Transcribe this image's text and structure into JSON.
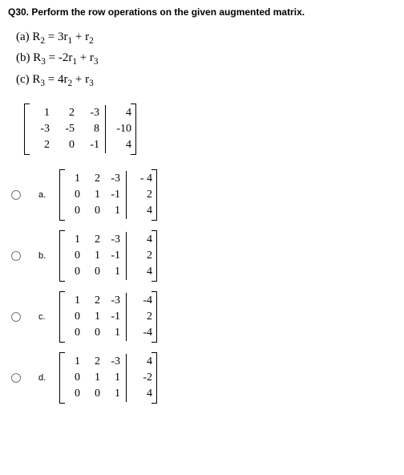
{
  "title": "Q30. Perform the row operations on the given augmented matrix.",
  "ops": {
    "a_prefix": "(a) R",
    "a_sub1": "2",
    "a_mid": " = 3r",
    "a_sub2": "1",
    "a_mid2": " + r",
    "a_sub3": "2",
    "b_prefix": "(b) R",
    "b_sub1": "3",
    "b_mid": " = -2r",
    "b_sub2": "1",
    "b_mid2": " + r",
    "b_sub3": "3",
    "c_prefix": "(c) R",
    "c_sub1": "3",
    "c_mid": " =  4r",
    "c_sub2": "2",
    "c_mid2": " + r",
    "c_sub3": "3"
  },
  "main_matrix": {
    "rows": [
      {
        "c1": "1",
        "c2": "2",
        "c3": "-3",
        "r": "4"
      },
      {
        "c1": "-3",
        "c2": "-5",
        "c3": "8",
        "r": "-10"
      },
      {
        "c1": "2",
        "c2": "0",
        "c3": "-1",
        "r": "4"
      }
    ]
  },
  "choices": {
    "a": {
      "label": "a.",
      "rows": [
        {
          "c1": "1",
          "c2": "2",
          "c3": "-3",
          "r": "- 4"
        },
        {
          "c1": "0",
          "c2": "1",
          "c3": "-1",
          "r": "2"
        },
        {
          "c1": "0",
          "c2": "0",
          "c3": "1",
          "r": "4"
        }
      ]
    },
    "b": {
      "label": "b.",
      "rows": [
        {
          "c1": "1",
          "c2": "2",
          "c3": "-3",
          "r": "4"
        },
        {
          "c1": "0",
          "c2": "1",
          "c3": "-1",
          "r": "2"
        },
        {
          "c1": "0",
          "c2": "0",
          "c3": "1",
          "r": "4"
        }
      ]
    },
    "c": {
      "label": "c.",
      "rows": [
        {
          "c1": "1",
          "c2": "2",
          "c3": "-3",
          "r": "-4"
        },
        {
          "c1": "0",
          "c2": "1",
          "c3": "-1",
          "r": "2"
        },
        {
          "c1": "0",
          "c2": "0",
          "c3": "1",
          "r": "-4"
        }
      ]
    },
    "d": {
      "label": "d.",
      "rows": [
        {
          "c1": "1",
          "c2": "2",
          "c3": "-3",
          "r": "4"
        },
        {
          "c1": "0",
          "c2": "1",
          "c3": "1",
          "r": "-2"
        },
        {
          "c1": "0",
          "c2": "0",
          "c3": "1",
          "r": "4"
        }
      ]
    }
  }
}
